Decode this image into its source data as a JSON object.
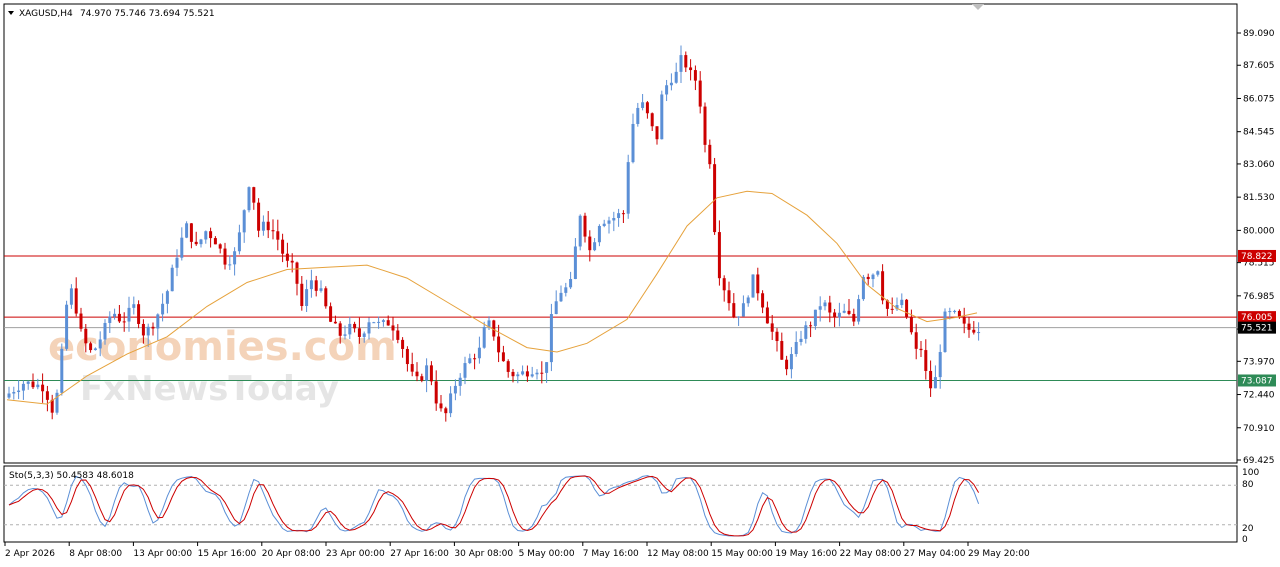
{
  "header": {
    "symbol_label": "XAGUSD,H4",
    "ohlc": "74.970 75.746 73.694 75.521"
  },
  "watermark": {
    "line1": "economies.com",
    "line2": "FxNewsToday"
  },
  "stochastic": {
    "label": "Sto(5,3,3) 50.4583 48.6018",
    "levels": [
      "100",
      "80",
      "20",
      "0"
    ],
    "colors": {
      "main": "#5b8fd6",
      "signal": "#cc0000",
      "level": "#b0b0b0"
    }
  },
  "colors": {
    "bull": "#5b8fd6",
    "bear": "#cc0000",
    "ma": "#e6a23c",
    "resistance": "#cc0000",
    "support": "#2e8b57",
    "price_line": "#a0a0a0"
  },
  "chart_data": {
    "type": "candlestick",
    "symbol": "XAGUSD",
    "timeframe": "H4",
    "ylim": [
      69.425,
      90.0
    ],
    "y_ticks": [
      "89.090",
      "87.605",
      "86.075",
      "84.545",
      "83.060",
      "81.530",
      "80.000",
      "78.515",
      "76.985",
      "75.455",
      "73.970",
      "72.440",
      "70.910",
      "69.425"
    ],
    "x_ticks": [
      "2 Apr 2026",
      "8 Apr 08:00",
      "13 Apr 00:00",
      "15 Apr 16:00",
      "20 Apr 08:00",
      "23 Apr 00:00",
      "27 Apr 16:00",
      "30 Apr 08:00",
      "5 May 00:00",
      "7 May 16:00",
      "12 May 08:00",
      "15 May 00:00",
      "19 May 16:00",
      "22 May 08:00",
      "27 May 04:00",
      "29 May 20:00"
    ],
    "horizontal_lines": [
      {
        "name": "resistance_upper",
        "value": 78.822,
        "label": "78.822"
      },
      {
        "name": "resistance_lower",
        "value": 76.005,
        "label": "76.005"
      },
      {
        "name": "support",
        "value": 73.087,
        "label": "73.087"
      }
    ],
    "current_price": {
      "value": 75.521,
      "label": "75.521"
    },
    "price_path": [
      [
        0,
        72.3
      ],
      [
        10,
        72.7
      ],
      [
        20,
        73.0
      ],
      [
        40,
        72.8
      ],
      [
        50,
        71.5
      ],
      [
        56,
        73.5
      ],
      [
        62,
        76.5
      ],
      [
        68,
        77.3
      ],
      [
        78,
        75.0
      ],
      [
        88,
        74.3
      ],
      [
        98,
        75.2
      ],
      [
        108,
        76.3
      ],
      [
        118,
        75.8
      ],
      [
        130,
        76.5
      ],
      [
        140,
        75.2
      ],
      [
        150,
        75.8
      ],
      [
        162,
        77.0
      ],
      [
        172,
        78.8
      ],
      [
        182,
        80.2
      ],
      [
        192,
        79.2
      ],
      [
        202,
        80.0
      ],
      [
        212,
        79.5
      ],
      [
        222,
        78.5
      ],
      [
        232,
        79.0
      ],
      [
        240,
        81.0
      ],
      [
        246,
        82.5
      ],
      [
        254,
        80.0
      ],
      [
        262,
        80.3
      ],
      [
        272,
        79.8
      ],
      [
        282,
        78.5
      ],
      [
        290,
        78.2
      ],
      [
        298,
        76.4
      ],
      [
        306,
        77.8
      ],
      [
        316,
        77.2
      ],
      [
        326,
        75.8
      ],
      [
        336,
        75.2
      ],
      [
        346,
        75.5
      ],
      [
        356,
        75.1
      ],
      [
        366,
        76.0
      ],
      [
        376,
        75.6
      ],
      [
        386,
        75.8
      ],
      [
        396,
        75.0
      ],
      [
        406,
        73.4
      ],
      [
        414,
        73.0
      ],
      [
        424,
        73.8
      ],
      [
        432,
        72.2
      ],
      [
        440,
        71.3
      ],
      [
        450,
        72.8
      ],
      [
        458,
        73.6
      ],
      [
        468,
        74.2
      ],
      [
        476,
        74.5
      ],
      [
        482,
        75.8
      ],
      [
        488,
        75.5
      ],
      [
        496,
        74.2
      ],
      [
        504,
        73.5
      ],
      [
        512,
        73.3
      ],
      [
        522,
        73.5
      ],
      [
        532,
        73.7
      ],
      [
        540,
        73.2
      ],
      [
        548,
        76.2
      ],
      [
        556,
        77.2
      ],
      [
        566,
        77.4
      ],
      [
        576,
        80.8
      ],
      [
        586,
        79.0
      ],
      [
        596,
        80.5
      ],
      [
        606,
        80.5
      ],
      [
        614,
        80.7
      ],
      [
        620,
        80.8
      ],
      [
        626,
        84.5
      ],
      [
        636,
        86.0
      ],
      [
        646,
        85.0
      ],
      [
        652,
        84.0
      ],
      [
        658,
        86.3
      ],
      [
        666,
        87.0
      ],
      [
        672,
        87.2
      ],
      [
        678,
        88.0
      ],
      [
        686,
        87.2
      ],
      [
        694,
        86.8
      ],
      [
        700,
        84.0
      ],
      [
        706,
        83.2
      ],
      [
        710,
        80.3
      ],
      [
        716,
        77.7
      ],
      [
        722,
        77.2
      ],
      [
        730,
        76.0
      ],
      [
        740,
        76.5
      ],
      [
        748,
        77.8
      ],
      [
        756,
        77.0
      ],
      [
        764,
        75.8
      ],
      [
        772,
        74.8
      ],
      [
        780,
        73.6
      ],
      [
        790,
        74.4
      ],
      [
        798,
        75.3
      ],
      [
        808,
        75.8
      ],
      [
        818,
        76.8
      ],
      [
        828,
        75.9
      ],
      [
        840,
        76.2
      ],
      [
        850,
        75.8
      ],
      [
        858,
        78.0
      ],
      [
        866,
        77.9
      ],
      [
        874,
        78.3
      ],
      [
        880,
        76.5
      ],
      [
        888,
        76.2
      ],
      [
        896,
        76.8
      ],
      [
        904,
        75.8
      ],
      [
        912,
        74.4
      ],
      [
        918,
        74.6
      ],
      [
        924,
        72.6
      ],
      [
        932,
        73.2
      ],
      [
        940,
        76.0
      ],
      [
        948,
        76.2
      ],
      [
        956,
        75.8
      ],
      [
        962,
        75.4
      ],
      [
        970,
        75.5
      ]
    ],
    "ma_path": [
      [
        0,
        72.2
      ],
      [
        40,
        72.0
      ],
      [
        80,
        73.3
      ],
      [
        120,
        74.3
      ],
      [
        160,
        75.1
      ],
      [
        200,
        76.5
      ],
      [
        240,
        77.6
      ],
      [
        280,
        78.2
      ],
      [
        320,
        78.3
      ],
      [
        360,
        78.4
      ],
      [
        400,
        77.8
      ],
      [
        440,
        76.7
      ],
      [
        480,
        75.6
      ],
      [
        520,
        74.6
      ],
      [
        550,
        74.4
      ],
      [
        580,
        74.8
      ],
      [
        620,
        75.9
      ],
      [
        650,
        78.0
      ],
      [
        680,
        80.2
      ],
      [
        710,
        81.5
      ],
      [
        740,
        81.8
      ],
      [
        765,
        81.7
      ],
      [
        800,
        80.7
      ],
      [
        830,
        79.4
      ],
      [
        860,
        77.5
      ],
      [
        890,
        76.4
      ],
      [
        920,
        75.8
      ],
      [
        950,
        76.0
      ],
      [
        970,
        76.2
      ]
    ]
  }
}
